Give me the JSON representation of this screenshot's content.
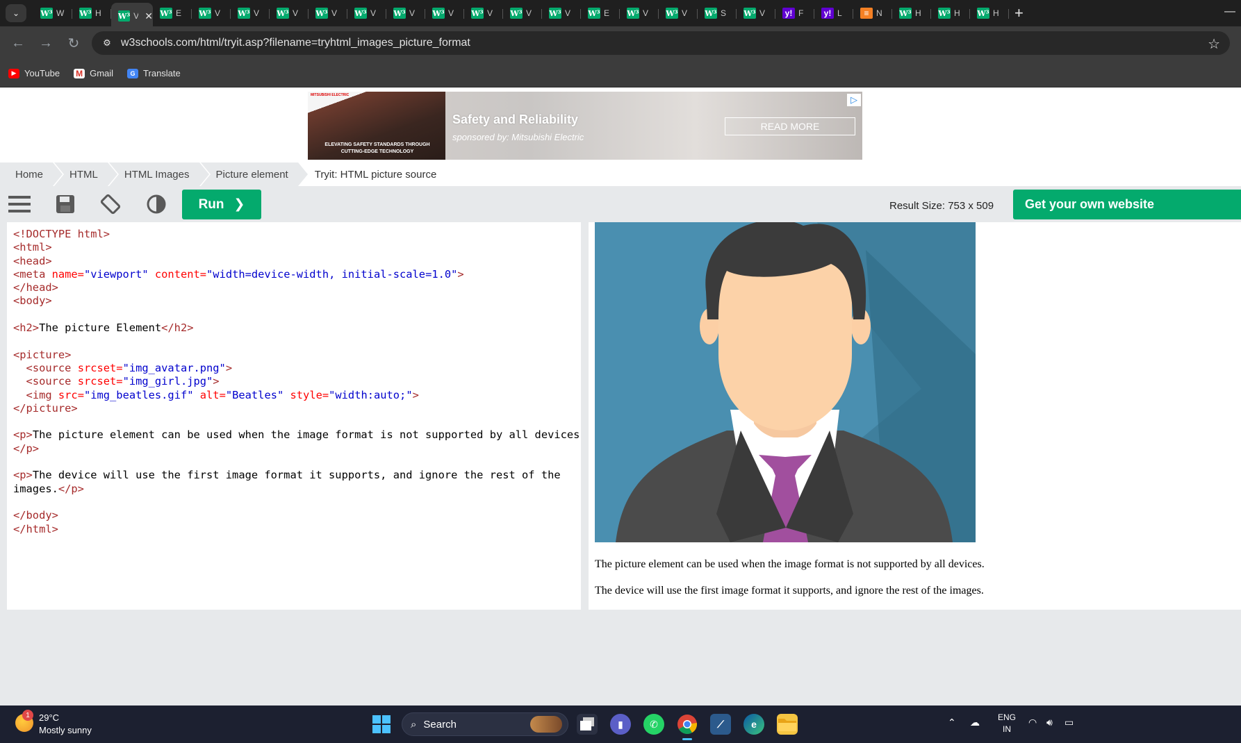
{
  "browser": {
    "tabs": [
      {
        "icon": "w3",
        "title": "W"
      },
      {
        "icon": "w3",
        "title": "H"
      },
      {
        "icon": "w3",
        "title": "V",
        "active": true
      },
      {
        "icon": "w3",
        "title": "E"
      },
      {
        "icon": "w3",
        "title": "V"
      },
      {
        "icon": "w3",
        "title": "V"
      },
      {
        "icon": "w3",
        "title": "V"
      },
      {
        "icon": "w3",
        "title": "V"
      },
      {
        "icon": "w3",
        "title": "V"
      },
      {
        "icon": "w3",
        "title": "V"
      },
      {
        "icon": "w3",
        "title": "V"
      },
      {
        "icon": "w3",
        "title": "V"
      },
      {
        "icon": "w3",
        "title": "V"
      },
      {
        "icon": "w3",
        "title": "V"
      },
      {
        "icon": "w3",
        "title": "E"
      },
      {
        "icon": "w3",
        "title": "V"
      },
      {
        "icon": "w3",
        "title": "V"
      },
      {
        "icon": "w3",
        "title": "S"
      },
      {
        "icon": "w3",
        "title": "V"
      },
      {
        "icon": "yh",
        "title": "F"
      },
      {
        "icon": "yh",
        "title": "L"
      },
      {
        "icon": "so",
        "title": "N"
      },
      {
        "icon": "w3",
        "title": "H"
      },
      {
        "icon": "w3",
        "title": "H"
      },
      {
        "icon": "w3",
        "title": "H"
      }
    ],
    "close_glyph": "✕",
    "new_tab_glyph": "+",
    "url": "w3schools.com/html/tryit.asp?filename=tryhtml_images_picture_format",
    "bookmarks": [
      {
        "label": "YouTube",
        "icon": "youtube-icon"
      },
      {
        "label": "Gmail",
        "icon": "gmail-icon"
      },
      {
        "label": "Translate",
        "icon": "translate-icon"
      }
    ]
  },
  "ad": {
    "title": "Safety and Reliability",
    "sponsor": "sponsored by: Mitsubishi Electric",
    "button": "READ MORE",
    "caption": "ELEVATING SAFETY STANDARDS THROUGH CUTTING-EDGE TECHNOLOGY",
    "logo": "MITSUBISHI ELECTRIC"
  },
  "breadcrumbs": [
    "Home",
    "HTML",
    "HTML Images",
    "Picture element",
    "Tryit: HTML picture source"
  ],
  "toolbar": {
    "run_label": "Run",
    "run_chevron": "❯",
    "result_size": "Result Size: 753 x 509",
    "get_own": "Get your own website"
  },
  "code_lines": [
    [
      [
        "tg",
        "<!DOCTYPE html>"
      ]
    ],
    [
      [
        "tg",
        "<html>"
      ]
    ],
    [
      [
        "tg",
        "<head>"
      ]
    ],
    [
      [
        "tg",
        "<meta "
      ],
      [
        "at",
        "name="
      ],
      [
        "vl",
        "\"viewport\""
      ],
      [
        "at",
        " content="
      ],
      [
        "vl",
        "\"width=device-width, initial-scale=1.0\""
      ],
      [
        "tg",
        ">"
      ]
    ],
    [
      [
        "tg",
        "</head>"
      ]
    ],
    [
      [
        "tg",
        "<body>"
      ]
    ],
    [],
    [
      [
        "tg",
        "<h2>"
      ],
      [
        "tx",
        "The picture Element"
      ],
      [
        "tg",
        "</h2>"
      ]
    ],
    [],
    [
      [
        "tg",
        "<picture>"
      ]
    ],
    [
      [
        "tx",
        "  "
      ],
      [
        "tg",
        "<source "
      ],
      [
        "at",
        "srcset="
      ],
      [
        "vl",
        "\"img_avatar.png\""
      ],
      [
        "tg",
        ">"
      ]
    ],
    [
      [
        "tx",
        "  "
      ],
      [
        "tg",
        "<source "
      ],
      [
        "at",
        "srcset="
      ],
      [
        "vl",
        "\"img_girl.jpg\""
      ],
      [
        "tg",
        ">"
      ]
    ],
    [
      [
        "tx",
        "  "
      ],
      [
        "tg",
        "<img "
      ],
      [
        "at",
        "src="
      ],
      [
        "vl",
        "\"img_beatles.gif\""
      ],
      [
        "at",
        " alt="
      ],
      [
        "vl",
        "\"Beatles\""
      ],
      [
        "at",
        " style="
      ],
      [
        "vl",
        "\"width:auto;\""
      ],
      [
        "tg",
        ">"
      ]
    ],
    [
      [
        "tg",
        "</picture>"
      ]
    ],
    [],
    [
      [
        "tg",
        "<p>"
      ],
      [
        "tx",
        "The picture element can be used when the image format is not supported by all devices."
      ]
    ],
    [
      [
        "tg",
        "</p>"
      ]
    ],
    [],
    [
      [
        "tg",
        "<p>"
      ],
      [
        "tx",
        "The device will use the first image format it supports, and ignore the rest of the"
      ]
    ],
    [
      [
        "tx",
        "images."
      ],
      [
        "tg",
        "</p>"
      ]
    ],
    [],
    [
      [
        "tg",
        "</body>"
      ]
    ],
    [
      [
        "tg",
        "</html>"
      ]
    ]
  ],
  "result": {
    "p1": "The picture element can be used when the image format is not supported by all devices.",
    "p2": "The device will use the first image format it supports, and ignore the rest of the images."
  },
  "taskbar": {
    "weather_badge": "1",
    "temperature": "29°C",
    "condition": "Mostly sunny",
    "search_label": "Search",
    "lang_top": "ENG",
    "lang_bottom": "IN"
  },
  "colors": {
    "w3_green": "#04aa6d",
    "tag": "#a52a2a",
    "attr": "#ff0000",
    "value": "#0000cd",
    "avatar_bg": "#4a8fb0"
  }
}
